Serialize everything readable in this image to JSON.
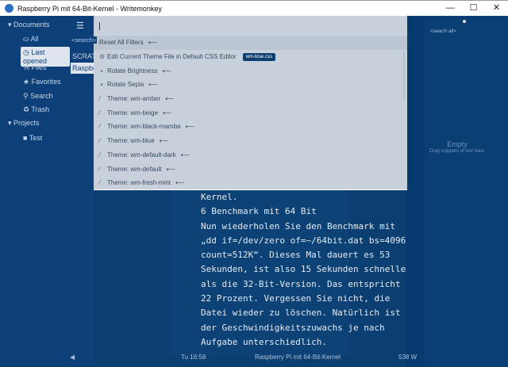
{
  "window": {
    "title": "Raspberry Pi mit 64-Bit-Kernel - Writemonkey",
    "icon": "WM",
    "min": "—",
    "max": "☐",
    "close": "✕"
  },
  "sidebar": {
    "documents": "Documents",
    "projects": "Projects",
    "items": [
      {
        "icon": "⛀",
        "label": "All"
      },
      {
        "icon": "◷",
        "label": "Last opened"
      },
      {
        "icon": "%",
        "label": "Files"
      },
      {
        "icon": "★",
        "label": "Favorites"
      },
      {
        "icon": "⚲",
        "label": "Search"
      },
      {
        "icon": "♻",
        "label": "Trash"
      }
    ],
    "project_items": [
      {
        "icon": "■",
        "label": "Test"
      }
    ]
  },
  "filelist": {
    "search": "<search>",
    "group": "SCRATCH",
    "item": "Raspberry"
  },
  "palette": {
    "items": [
      {
        "icon": "",
        "label": "Reset All Filters"
      },
      {
        "icon": "⚙",
        "label": "Edit Current Theme File in Default CSS Editor",
        "badge": "wm-blue.css"
      },
      {
        "icon": "◑",
        "label": "Rotate Brightness"
      },
      {
        "icon": "◑",
        "label": "Rotate Sepia"
      },
      {
        "icon": "⁄",
        "label": "Theme: wm-amber"
      },
      {
        "icon": "⁄",
        "label": "Theme: wm-beige"
      },
      {
        "icon": "⁄",
        "label": "Theme: wm-black-mamba"
      },
      {
        "icon": "⁄",
        "label": "Theme: wm-blue"
      },
      {
        "icon": "⁄",
        "label": "Theme: wm-default-dark"
      },
      {
        "icon": "⁄",
        "label": "Theme: wm-default"
      },
      {
        "icon": "⁄",
        "label": "Theme: wm-fresh-mint"
      }
    ],
    "arrow": "⟵"
  },
  "editor": {
    "lines": [
      "Kernel.",
      "6 Benchmark mit 64 Bit",
      "Nun wiederholen Sie den Benchmark mit",
      "„dd if=/dev/zero of=~/64bit.dat bs=4096",
      "count=512K“. Dieses Mal dauert es 53",
      "Sekunden, ist also 15 Sekunden schneller",
      "als die 32-Bit-Version. Das entspricht",
      "22 Prozent. Vergessen Sie nicht, die",
      "Datei wieder zu löschen. Natürlich ist",
      "der Geschwindigkeitszuwachs je nach",
      "Aufgabe unterschiedlich."
    ]
  },
  "right": {
    "search": "<search all>",
    "empty": "Empty",
    "hint": "Drag snippets of text here."
  },
  "status": {
    "time": "Tu 16:58",
    "doc": "Raspberry Pi mit 64-Bit-Kernel",
    "words": "538 W",
    "back": "◀"
  }
}
